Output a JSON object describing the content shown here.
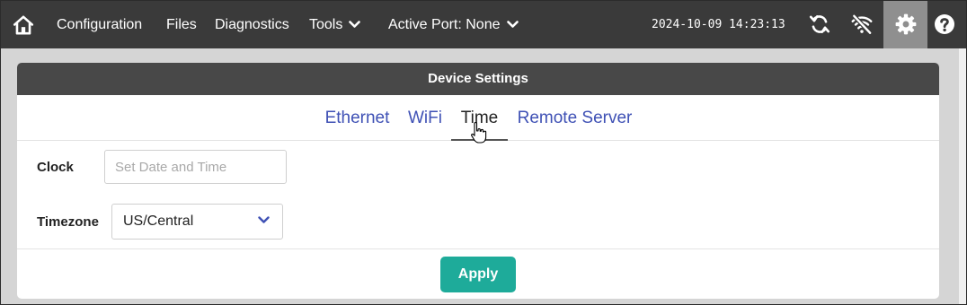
{
  "topbar": {
    "home_icon": "home-icon",
    "items": [
      {
        "label": "Configuration"
      },
      {
        "label": "Files"
      },
      {
        "label": "Diagnostics"
      },
      {
        "label": "Tools",
        "icon": "chevron-down-icon"
      },
      {
        "label": "Active Port: None",
        "icon": "chevron-down-icon"
      }
    ],
    "datetime": "2024-10-09 14:23:13",
    "icons": [
      "sync-icon",
      "wifi-off-icon",
      "gear-icon",
      "help-icon"
    ],
    "active_icon": "gear-icon"
  },
  "card": {
    "title": "Device Settings",
    "tabs": [
      {
        "label": "Ethernet"
      },
      {
        "label": "WiFi"
      },
      {
        "label": "Time",
        "active": true
      },
      {
        "label": "Remote Server"
      }
    ],
    "clock": {
      "label": "Clock",
      "value": "",
      "placeholder": "Set Date and Time"
    },
    "timezone": {
      "label": "Timezone",
      "value": "US/Central",
      "icon": "chevron-down-icon"
    },
    "apply_label": "Apply"
  },
  "colors": {
    "topbar": "#3a3a3a",
    "active_icon_bg": "#8f8f8f",
    "card_header": "#484848",
    "tab_link": "#3f51b5",
    "apply_button": "#1eab9a",
    "content_bg": "#d5d5d5"
  }
}
